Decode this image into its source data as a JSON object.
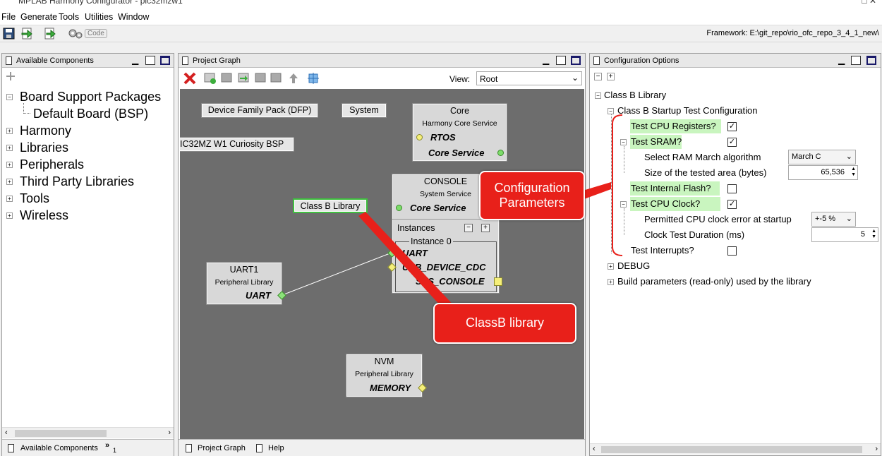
{
  "window": {
    "title": "MPLAB Harmony Configurator - pic32mzw1",
    "controls": "□  ✕"
  },
  "menu": [
    "File",
    "Generate",
    "Tools",
    "Utilities",
    "Window"
  ],
  "toolbar": {
    "code_label": "Code",
    "framework_label": "Framework: E:\\git_repo\\rio_ofc_repo_3_4_1_new\\"
  },
  "left_panel": {
    "title": "Available Components",
    "items": [
      {
        "label": "Board Support Packages"
      },
      {
        "label": "Default Board (BSP)"
      },
      {
        "label": "Harmony"
      },
      {
        "label": "Libraries"
      },
      {
        "label": "Peripherals"
      },
      {
        "label": "Third Party Libraries"
      },
      {
        "label": "Tools"
      },
      {
        "label": "Wireless"
      }
    ],
    "bottom_tab": "Available Components",
    "more_tabs": "»",
    "more_count": "1"
  },
  "graph_panel": {
    "title": "Project Graph",
    "view_label": "View:",
    "view_value": "Root",
    "nodes": {
      "dfp": "Device Family Pack (DFP)",
      "system": "System",
      "bsp": "IC32MZ W1 Curiosity BSP",
      "classb": "Class B Library",
      "core_title": "Core",
      "core_sub": "Harmony Core Service",
      "core_rtos": "RTOS",
      "core_service": "Core Service",
      "console_title": "CONSOLE",
      "console_sub": "System Service",
      "console_core": "Core Service",
      "instances": "Instances",
      "instance0": "Instance 0",
      "console_uart": "UART",
      "console_usb": "USB_DEVICE_CDC",
      "console_sys": "SYS_CONSOLE",
      "uart1_title": "UART1",
      "uart1_sub": "Peripheral Library",
      "uart1_b": "UART",
      "nvm_title": "NVM",
      "nvm_sub": "Peripheral Library",
      "nvm_b": "MEMORY"
    },
    "tab_graph": "Project Graph",
    "tab_help": "Help"
  },
  "config_panel": {
    "title": "Configuration Options",
    "root": "Class B Library",
    "startup": "Class B Startup Test Configuration",
    "test_cpu_regs": "Test CPU Registers?",
    "test_sram": "Test SRAM?",
    "ram_algo_label": "Select RAM March algorithm",
    "ram_algo_value": "March C",
    "size_label": "Size of the tested area (bytes)",
    "size_value": "65,536",
    "test_flash": "Test Internal Flash?",
    "test_clock": "Test CPU Clock?",
    "clock_err_label": "Permitted CPU clock error at startup",
    "clock_err_value": "+-5 %",
    "clock_dur_label": "Clock Test Duration (ms)",
    "clock_dur_value": "5",
    "test_int": "Test Interrupts?",
    "debug": "DEBUG",
    "build": "Build parameters (read-only) used by the library"
  },
  "callouts": {
    "config": "Configuration\nParameters",
    "classb": "ClassB library"
  },
  "colors": {
    "graph_bg": "#6d6d6d",
    "callout": "#e8201a",
    "highlight": "#c9f5bf"
  }
}
